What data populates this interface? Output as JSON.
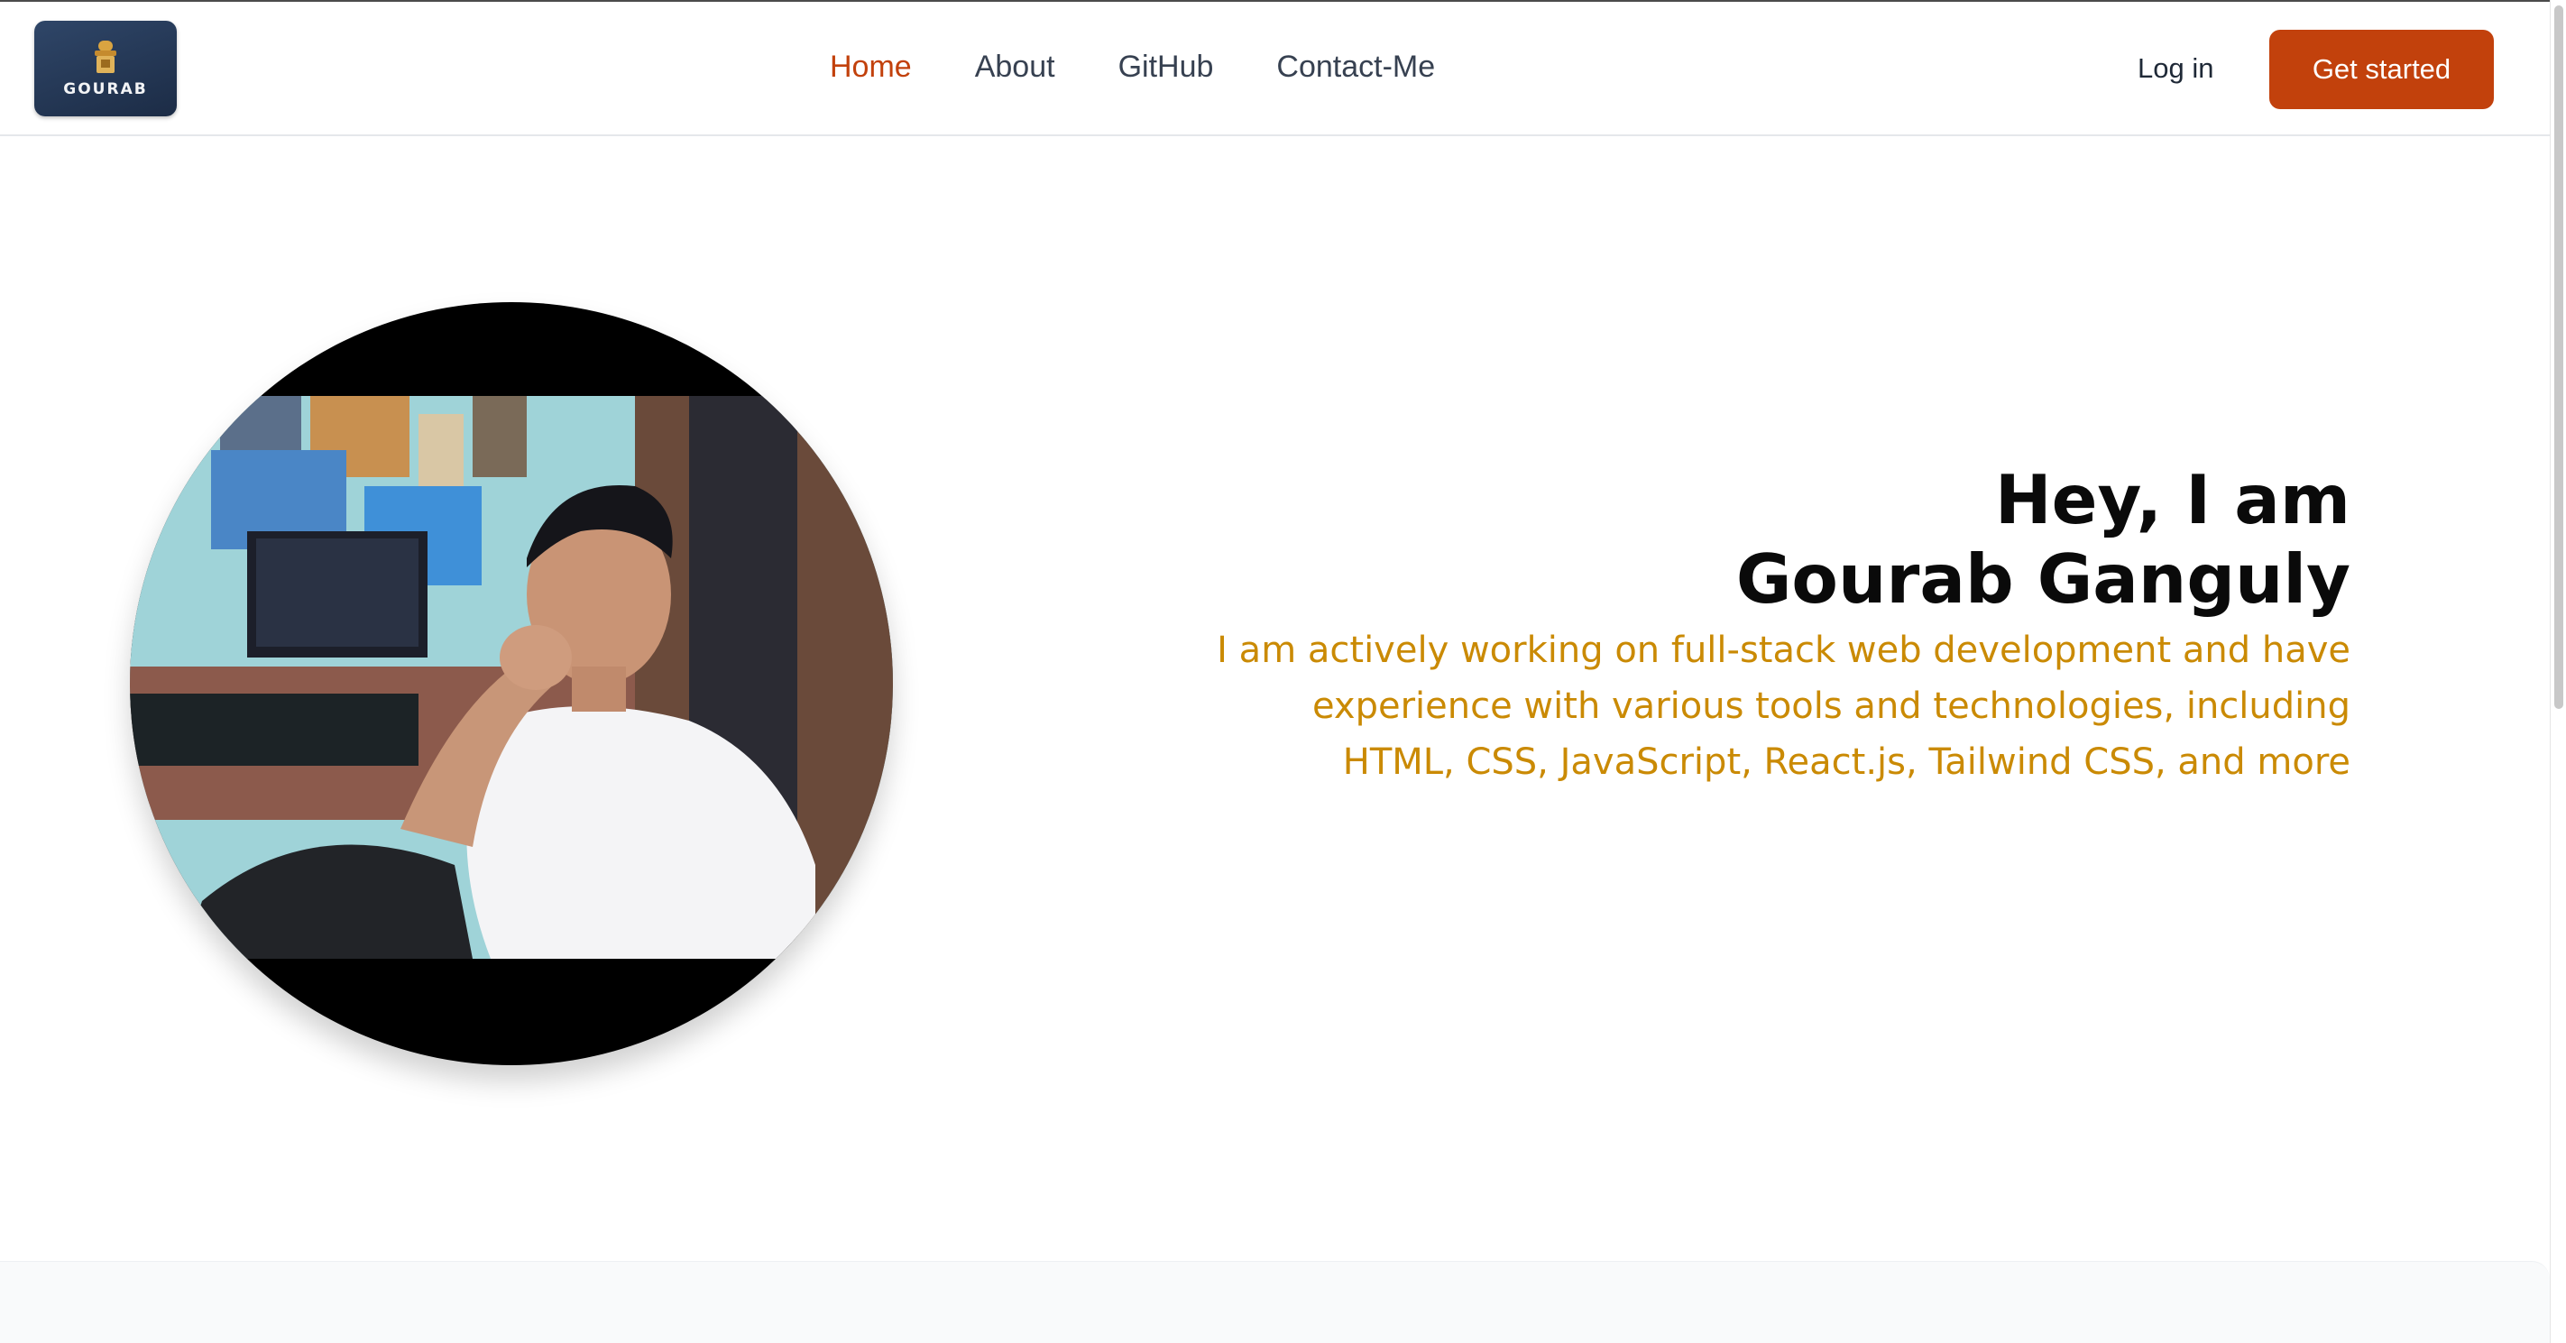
{
  "header": {
    "logo_text": "GOURAB",
    "nav": [
      {
        "label": "Home",
        "active": true
      },
      {
        "label": "About",
        "active": false
      },
      {
        "label": "GitHub",
        "active": false
      },
      {
        "label": "Contact-Me",
        "active": false
      }
    ],
    "login_label": "Log in",
    "cta_label": "Get started"
  },
  "hero": {
    "title_line1": "Hey, I am",
    "title_line2": "Gourab Ganguly",
    "subtitle_line1": "I am actively working on full-stack web development and have",
    "subtitle_line2": "experience with various tools and technologies, including",
    "subtitle_line3": "HTML, CSS, JavaScript, React.js, Tailwind CSS, and more"
  },
  "colors": {
    "accent": "#c2410c",
    "subtitle": "#ca8a04",
    "logo_bg": "#22324f"
  }
}
